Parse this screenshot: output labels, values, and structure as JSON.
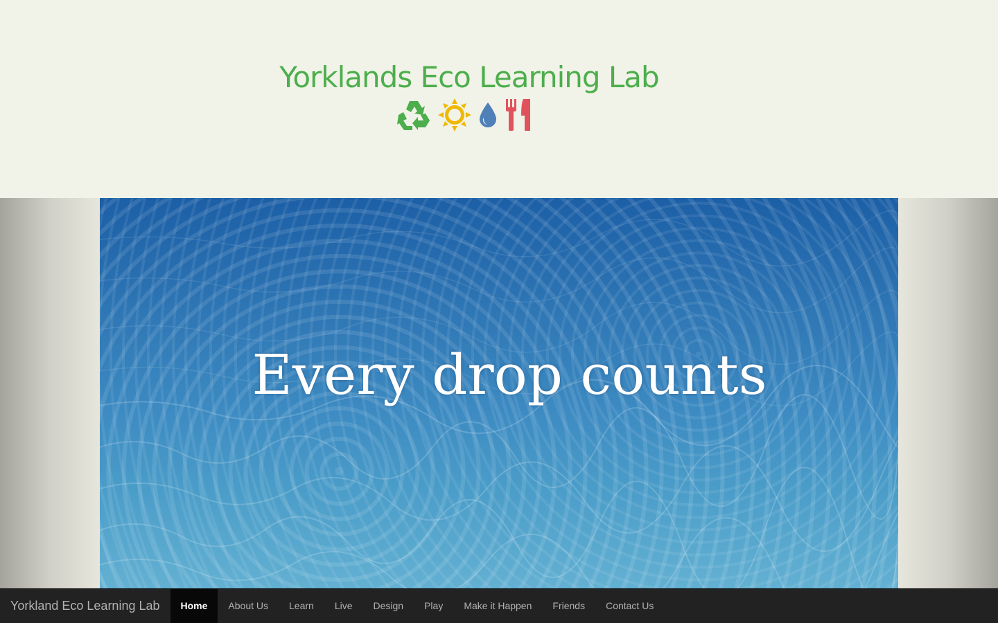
{
  "header": {
    "site_title": "Yorklands Eco Learning Lab",
    "icons": [
      "recycle-icon",
      "sun-icon",
      "water-drop-icon",
      "utensils-icon"
    ],
    "colors": {
      "title": "#4cae4c",
      "recycle": "#4cae4c",
      "sun": "#f0b800",
      "drop": "#4f80b8",
      "utensils": "#e0535d",
      "background": "#f1f3e8"
    }
  },
  "hero": {
    "image": "water-surface-image",
    "caption": "Every drop counts"
  },
  "navbar": {
    "brand": "Yorkland Eco Learning Lab",
    "items": [
      {
        "label": "Home",
        "active": true
      },
      {
        "label": "About Us",
        "active": false
      },
      {
        "label": "Learn",
        "active": false
      },
      {
        "label": "Live",
        "active": false
      },
      {
        "label": "Design",
        "active": false
      },
      {
        "label": "Play",
        "active": false
      },
      {
        "label": "Make it Happen",
        "active": false
      },
      {
        "label": "Friends",
        "active": false
      },
      {
        "label": "Contact Us",
        "active": false
      }
    ]
  }
}
